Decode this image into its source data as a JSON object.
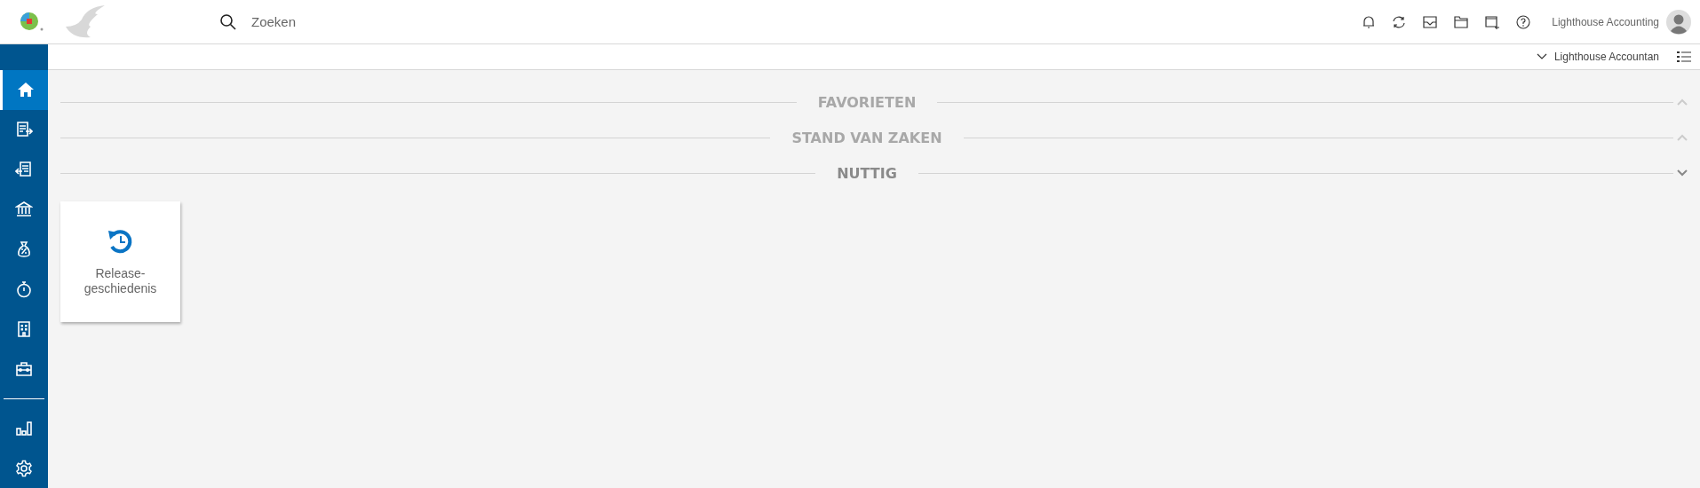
{
  "topbar": {
    "search": {
      "placeholder": "Zoeken"
    },
    "user_name": "Lighthouse Accounting"
  },
  "subbar": {
    "organisation": "Lighthouse Accountan"
  },
  "sidebar": {
    "items": [
      {
        "kind": "home",
        "selected": true
      },
      {
        "kind": "sales",
        "selected": false
      },
      {
        "kind": "purchase",
        "selected": false
      },
      {
        "kind": "bank",
        "selected": false
      },
      {
        "kind": "tax",
        "selected": false
      },
      {
        "kind": "timer",
        "selected": false
      },
      {
        "kind": "building",
        "selected": false
      },
      {
        "kind": "toolbox",
        "selected": false
      },
      {
        "kind": "divider"
      },
      {
        "kind": "chart",
        "selected": false
      },
      {
        "kind": "settings",
        "selected": false
      }
    ]
  },
  "sections": [
    {
      "title": "FAVORIETEN",
      "expanded": false
    },
    {
      "title": "STAND VAN ZAKEN",
      "expanded": false
    },
    {
      "title": "NUTTIG",
      "expanded": true,
      "tiles": [
        {
          "label": "Release-\ngeschiedenis"
        }
      ]
    }
  ]
}
